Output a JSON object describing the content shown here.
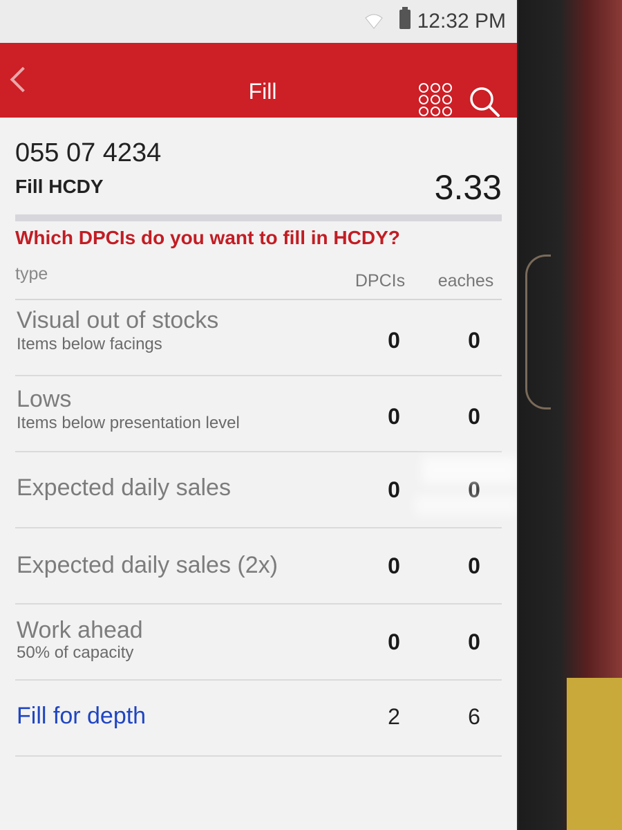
{
  "status_bar": {
    "time": "12:32 PM"
  },
  "app_bar": {
    "title": "Fill"
  },
  "header": {
    "location_code": "055 07 4234",
    "department": "Fill HCDY",
    "value": "3.33"
  },
  "question": "Which DPCIs do you want to fill in HCDY?",
  "columns": {
    "type": "type",
    "dpcis": "DPCIs",
    "eaches": "eaches"
  },
  "rows": [
    {
      "title": "Visual out of stocks",
      "subtitle": "Items below facings",
      "dpcis": "0",
      "eaches": "0"
    },
    {
      "title": "Lows",
      "subtitle": "Items below presentation level",
      "dpcis": "0",
      "eaches": "0"
    },
    {
      "title": "Expected daily sales",
      "dpcis": "0",
      "eaches": "0"
    },
    {
      "title": "Expected daily sales (2x)",
      "dpcis": "0",
      "eaches": "0"
    },
    {
      "title": "Work ahead",
      "subtitle": "50% of capacity",
      "dpcis": "0",
      "eaches": "0"
    },
    {
      "title": "Fill for depth",
      "dpcis": "2",
      "eaches": "6"
    }
  ],
  "colors": {
    "app_bar": "#cc1f26",
    "question": "#c21d24",
    "link": "#1f45c2"
  },
  "icons": {
    "back": "chevron-left-icon",
    "grid": "grid-icon",
    "search": "search-icon",
    "wifi": "wifi-icon",
    "battery": "battery-icon"
  }
}
